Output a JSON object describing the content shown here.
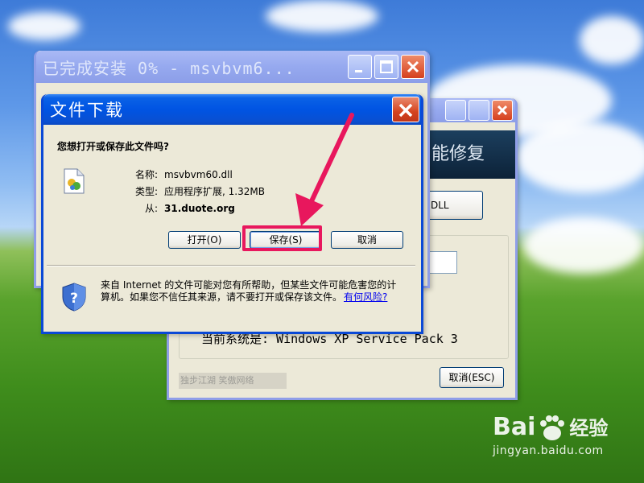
{
  "back_window": {
    "banner_text": "能修复",
    "dll_button_label": "DLL",
    "system_text": "当前系统是: Windows XP Service Pack 3",
    "footer_credit": "独步江湖 笑傲网络",
    "cancel_label": "取消(ESC)"
  },
  "install_window": {
    "title": "已完成安装 0% - msvbvm6..."
  },
  "download_dialog": {
    "title": "文件下载",
    "question": "您想打开或保存此文件吗?",
    "name_label": "名称:",
    "name_value": "msvbvm60.dll",
    "type_label": "类型:",
    "type_value": "应用程序扩展, 1.32MB",
    "from_label": "从:",
    "from_value": "31.duote.org",
    "open_label": "打开(O)",
    "save_label": "保存(S)",
    "cancel_label": "取消",
    "warning_text": "来自 Internet 的文件可能对您有所帮助，但某些文件可能危害您的计算机。如果您不信任其来源，请不要打开或保存该文件。",
    "risk_link": "有何风险?"
  },
  "watermark": {
    "brand": "Bai",
    "brand_suffix": "经验",
    "url": "jingyan.baidu.com"
  },
  "colors": {
    "highlight": "#e8175d",
    "xp_blue": "#0054e3"
  }
}
